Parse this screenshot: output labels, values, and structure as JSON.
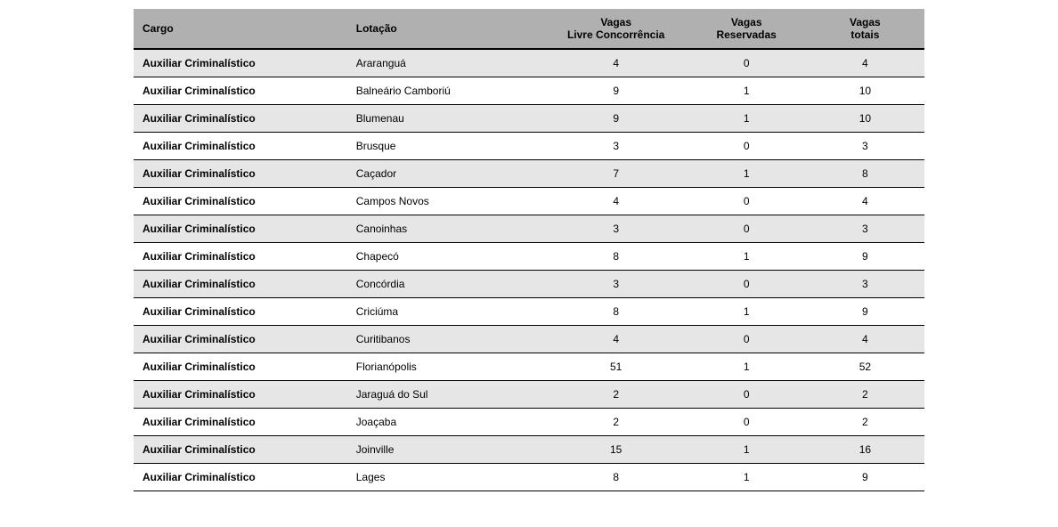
{
  "table": {
    "headers": {
      "cargo": "Cargo",
      "lotacao": "Lotação",
      "vagas_livre_line1": "Vagas",
      "vagas_livre_line2": "Livre Concorrência",
      "vagas_reservadas_line1": "Vagas",
      "vagas_reservadas_line2": "Reservadas",
      "vagas_totais_line1": "Vagas",
      "vagas_totais_line2": "totais"
    },
    "rows": [
      {
        "cargo": "Auxiliar Criminalístico",
        "lotacao": "Araranguá",
        "livre": "4",
        "reservadas": "0",
        "totais": "4"
      },
      {
        "cargo": "Auxiliar Criminalístico",
        "lotacao": "Balneário Camboriú",
        "livre": "9",
        "reservadas": "1",
        "totais": "10"
      },
      {
        "cargo": "Auxiliar Criminalístico",
        "lotacao": "Blumenau",
        "livre": "9",
        "reservadas": "1",
        "totais": "10"
      },
      {
        "cargo": "Auxiliar Criminalístico",
        "lotacao": "Brusque",
        "livre": "3",
        "reservadas": "0",
        "totais": "3"
      },
      {
        "cargo": "Auxiliar Criminalístico",
        "lotacao": "Caçador",
        "livre": "7",
        "reservadas": "1",
        "totais": "8"
      },
      {
        "cargo": "Auxiliar Criminalístico",
        "lotacao": "Campos Novos",
        "livre": "4",
        "reservadas": "0",
        "totais": "4"
      },
      {
        "cargo": "Auxiliar Criminalístico",
        "lotacao": "Canoinhas",
        "livre": "3",
        "reservadas": "0",
        "totais": "3"
      },
      {
        "cargo": "Auxiliar Criminalístico",
        "lotacao": "Chapecó",
        "livre": "8",
        "reservadas": "1",
        "totais": "9"
      },
      {
        "cargo": "Auxiliar Criminalístico",
        "lotacao": "Concórdia",
        "livre": "3",
        "reservadas": "0",
        "totais": "3"
      },
      {
        "cargo": "Auxiliar Criminalístico",
        "lotacao": "Criciúma",
        "livre": "8",
        "reservadas": "1",
        "totais": "9"
      },
      {
        "cargo": "Auxiliar Criminalístico",
        "lotacao": "Curitibanos",
        "livre": "4",
        "reservadas": "0",
        "totais": "4"
      },
      {
        "cargo": "Auxiliar Criminalístico",
        "lotacao": "Florianópolis",
        "livre": "51",
        "reservadas": "1",
        "totais": "52"
      },
      {
        "cargo": "Auxiliar Criminalístico",
        "lotacao": "Jaraguá do Sul",
        "livre": "2",
        "reservadas": "0",
        "totais": "2"
      },
      {
        "cargo": "Auxiliar Criminalístico",
        "lotacao": "Joaçaba",
        "livre": "2",
        "reservadas": "0",
        "totais": "2"
      },
      {
        "cargo": "Auxiliar Criminalístico",
        "lotacao": "Joinville",
        "livre": "15",
        "reservadas": "1",
        "totais": "16"
      },
      {
        "cargo": "Auxiliar Criminalístico",
        "lotacao": "Lages",
        "livre": "8",
        "reservadas": "1",
        "totais": "9"
      }
    ]
  }
}
